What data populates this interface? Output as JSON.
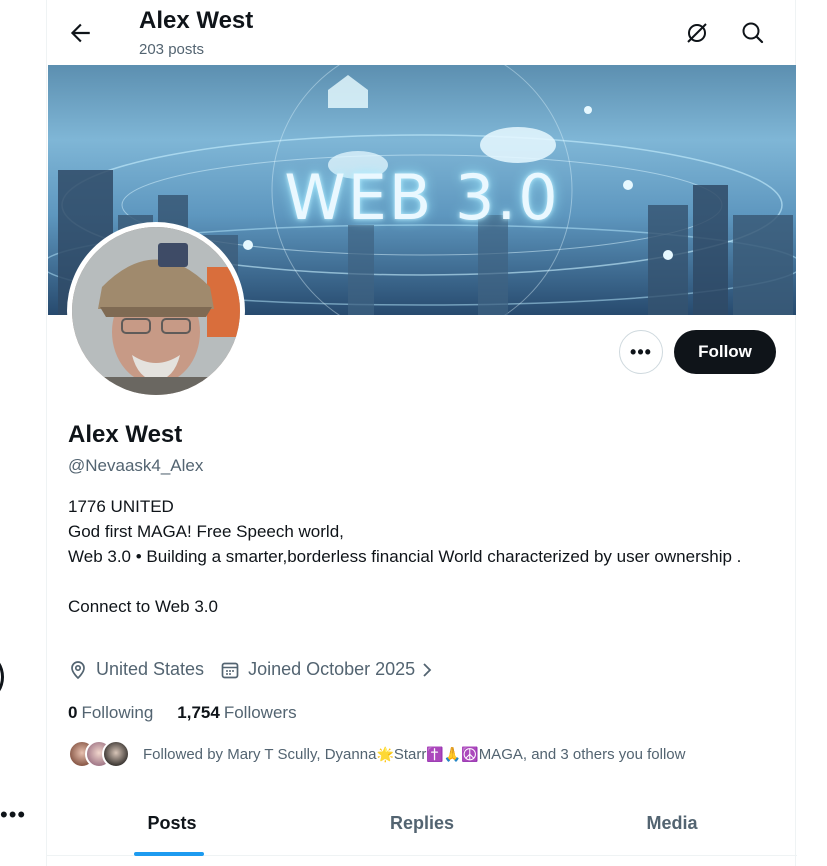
{
  "header": {
    "title": "Alex West",
    "posts_count": "203 posts"
  },
  "banner": {
    "text": "WEB 3.0"
  },
  "actions": {
    "more_label": "•••",
    "follow_label": "Follow"
  },
  "profile": {
    "name": "Alex West",
    "handle": "@Nevaask4_Alex",
    "bio": "1776 UNITED\nGod first MAGA! Free Speech world,\n Web 3.0 • Building a smarter,borderless financial World characterized by user ownership .\n\nConnect to Web 3.0",
    "location": "United States",
    "joined": "Joined October 2025",
    "following_count": "0",
    "following_label": "Following",
    "followers_count": "1,754",
    "followers_label": "Followers",
    "followed_by_prefix": "Followed by Mary T Scully, Dyanna",
    "followed_by_emoji1": "🌟",
    "followed_by_mid": "Starr",
    "followed_by_emoji2": "✝️🙏☮️",
    "followed_by_suffix": "MAGA, and 3 others you follow"
  },
  "tabs": [
    {
      "label": "Posts",
      "active": true
    },
    {
      "label": "Replies",
      "active": false
    },
    {
      "label": "Media",
      "active": false
    }
  ],
  "left_rail": {
    "more_label": "•••"
  },
  "colors": {
    "accent": "#1d9bf0",
    "text_primary": "#0f1419",
    "text_secondary": "#536471",
    "follow_bg": "#0f1419"
  }
}
